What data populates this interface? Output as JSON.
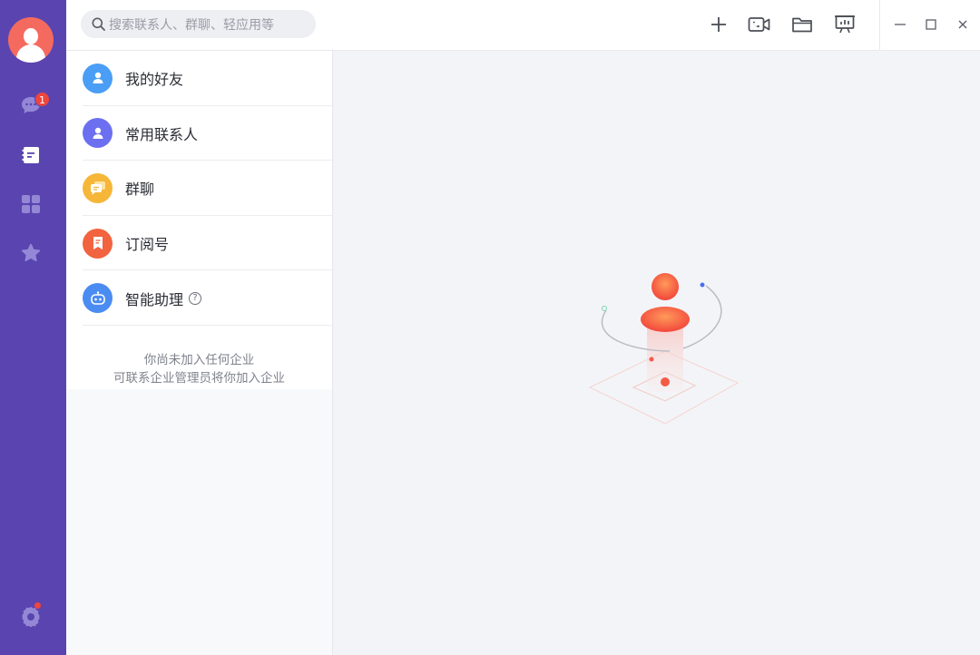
{
  "sidebar": {
    "items": [
      {
        "name": "messages",
        "badge": "1"
      },
      {
        "name": "contacts"
      },
      {
        "name": "workbench"
      },
      {
        "name": "favorites"
      }
    ]
  },
  "search": {
    "placeholder": "搜索联系人、群聊、轻应用等"
  },
  "contacts": {
    "items": [
      {
        "label": "我的好友",
        "color": "#4a9ef5"
      },
      {
        "label": "常用联系人",
        "color": "#6b6ff0"
      },
      {
        "label": "群聊",
        "color": "#f6b638"
      },
      {
        "label": "订阅号",
        "color": "#f2633f"
      },
      {
        "label": "智能助理",
        "color": "#4a8cf2",
        "help": "?"
      }
    ],
    "note_line1": "你尚未加入任何企业",
    "note_line2": "可联系企业管理员将你加入企业"
  },
  "colors": {
    "rail": "#5a45b0",
    "accent": "#f0453b"
  }
}
